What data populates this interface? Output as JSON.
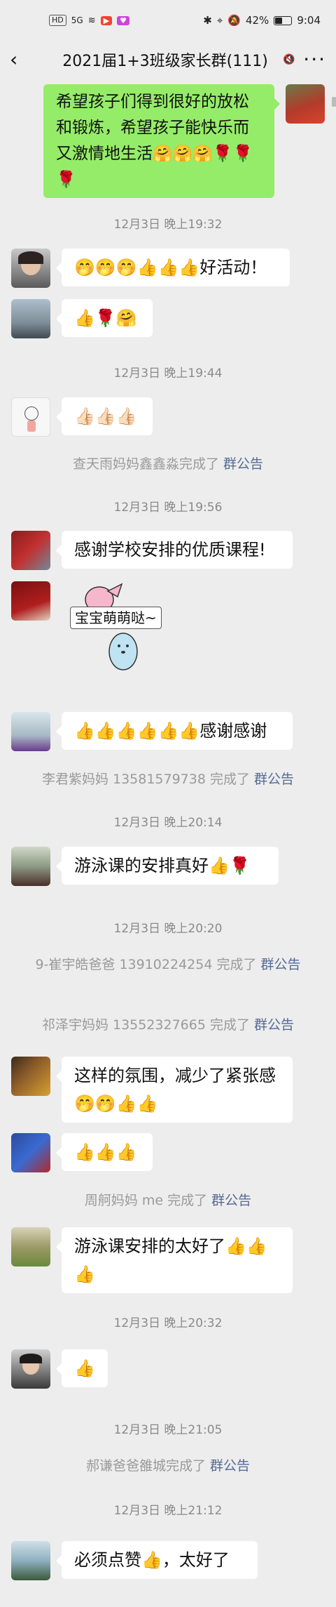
{
  "status": {
    "left_badges": [
      "HD",
      "5G",
      "",
      ""
    ],
    "battery": "42%",
    "time": "9:04",
    "battery_level": 0.42
  },
  "header": {
    "title": "2021届1+3班级家长群(111)",
    "more": "···"
  },
  "messages": {
    "m0": "希望孩子们得到很好的放松和锻炼，希望孩子能快乐而又激情地生活🤗🤗🤗🌹🌹🌹",
    "t1": "12月3日 晚上19:32",
    "m1": "🤭🤭🤭👍👍👍好活动！",
    "m2": "👍🌹🤗",
    "t2": "12月3日 晚上19:44",
    "m3": "👍🏻👍🏻👍🏻",
    "n1_text": "查天雨妈妈鑫鑫淼完成了 ",
    "n1_link": "群公告",
    "t3": "12月3日 晚上19:56",
    "m4": "感谢学校安排的优质课程!",
    "sticker_text": "宝宝萌萌哒~",
    "m5": "👍👍👍👍👍👍感谢感谢",
    "n2_text": "李君紫妈妈 13581579738 完成了 ",
    "n2_link": "群公告",
    "t4": "12月3日 晚上20:14",
    "m6": "游泳课的安排真好👍🌹",
    "t5": "12月3日 晚上20:20",
    "n3_text": "9-崔宇皓爸爸 13910224254 完成了 ",
    "n3_link": "群公告",
    "n4_text": "祁泽宇妈妈 13552327665 完成了 ",
    "n4_link": "群公告",
    "m7": "这样的氛围，减少了紧张感🤭🤭👍👍",
    "m8": "👍👍👍",
    "n5_text": "周舸妈妈 me 完成了 ",
    "n5_link": "群公告",
    "m9": "游泳课安排的太好了👍👍👍",
    "t6": "12月3日 晚上20:32",
    "m10": "👍",
    "t7": "12月3日 晚上21:05",
    "n6_text": "郝谦爸爸雒城完成了 ",
    "n6_link": "群公告",
    "t8": "12月3日 晚上21:12",
    "m11": "必须点赞👍，太好了"
  }
}
